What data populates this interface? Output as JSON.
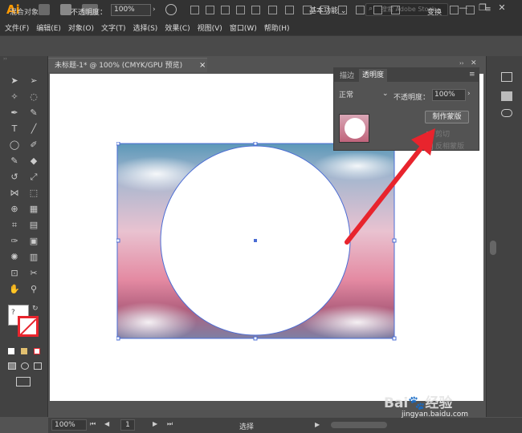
{
  "app": {
    "logo": "Ai",
    "workspace": "基本功能",
    "search_placeholder": "搜索 Adobe Stock",
    "window_buttons": [
      "—",
      "❐",
      "✕"
    ]
  },
  "menu": [
    "文件(F)",
    "编辑(E)",
    "对象(O)",
    "文字(T)",
    "选择(S)",
    "效果(C)",
    "视图(V)",
    "窗口(W)",
    "帮助(H)"
  ],
  "control_bar": {
    "selection_label": "混合对象",
    "opacity_label": "不透明度：",
    "opacity_value": "100%",
    "transform_label": "变换"
  },
  "document_tab": {
    "title": "未标题-1* @ 100% (CMYK/GPU 预览)",
    "close": "×"
  },
  "transparency_panel": {
    "tabs": [
      "描边",
      "透明度"
    ],
    "blend_mode": "正常",
    "opacity_label": "不透明度：",
    "opacity_value": "100%",
    "make_mask_button": "制作蒙版",
    "clip_label": "剪切",
    "invert_mask_label": "反相蒙版"
  },
  "status_bar": {
    "zoom": "100%",
    "artboard_number": "1",
    "status_text": "选择"
  },
  "tool_icons": [
    "selection-icon",
    "direct-selection-icon",
    "magic-wand-icon",
    "lasso-icon",
    "pen-icon",
    "curvature-icon",
    "type-icon",
    "line-icon",
    "ellipse-icon",
    "paintbrush-icon",
    "shaper-icon",
    "eraser-icon",
    "rotate-icon",
    "scale-icon",
    "width-icon",
    "free-transform-icon",
    "shape-builder-icon",
    "perspective-icon",
    "mesh-icon",
    "gradient-icon",
    "eyedropper-icon",
    "blend-icon",
    "symbol-sprayer-icon",
    "column-graph-icon",
    "artboard-icon",
    "slice-icon",
    "hand-icon",
    "zoom-icon"
  ],
  "watermark": {
    "brand": "Bai🐾经验",
    "url": "jingyan.baidu.com"
  },
  "colors": {
    "ui_dark": "#323232",
    "ui_mid": "#424242",
    "canvas": "#535353",
    "selection_blue": "#4a6cd4",
    "arrow_red": "#e8242d"
  }
}
